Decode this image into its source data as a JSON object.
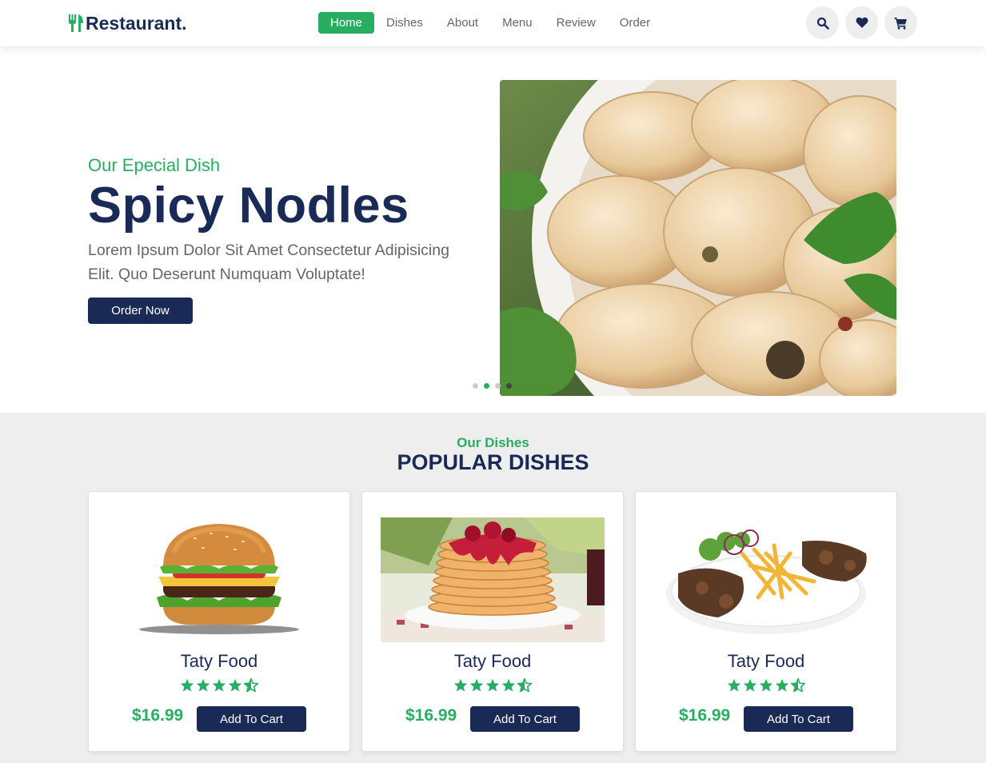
{
  "brand": {
    "name": "Restaurant.",
    "accent": "#27ae60",
    "primary": "#192a56"
  },
  "nav": [
    "Home",
    "Dishes",
    "About",
    "Menu",
    "Review",
    "Order"
  ],
  "nav_active": "Home",
  "header_icons": [
    "search-icon",
    "heart-icon",
    "cart-icon"
  ],
  "hero": {
    "subtitle": "Our Epecial Dish",
    "title": "Spicy Nodles",
    "description": "Lorem Ipsum Dolor Sit Amet Consectetur Adipisicing Elit. Quo Deserunt Numquam Voluptate!",
    "button": "Order Now",
    "slides": 4,
    "active_slide": 2
  },
  "dishes": {
    "subtitle": "Our Dishes",
    "title": "POPULAR DISHES",
    "cards": [
      {
        "name": "Taty Food",
        "price": "$16.99",
        "button": "Add To Cart",
        "rating": 4.5,
        "image": "burger"
      },
      {
        "name": "Taty Food",
        "price": "$16.99",
        "button": "Add To Cart",
        "rating": 4.5,
        "image": "pancakes"
      },
      {
        "name": "Taty Food",
        "price": "$16.99",
        "button": "Add To Cart",
        "rating": 4.5,
        "image": "steak-fries"
      }
    ]
  }
}
